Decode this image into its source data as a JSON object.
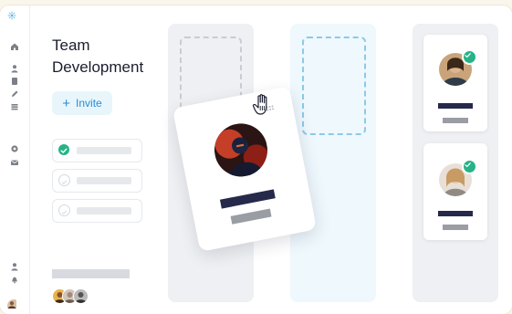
{
  "app": {
    "title": "Team Development",
    "invite_label": "Invite"
  },
  "rail": {
    "icons": [
      "home-icon",
      "user-icon",
      "document-icon",
      "pen-icon",
      "list-icon",
      "gear-icon",
      "mail-icon",
      "person-icon",
      "bell-icon"
    ]
  },
  "tasks": [
    {
      "state": "done"
    },
    {
      "state": "todo"
    },
    {
      "state": "todo"
    }
  ],
  "colors": {
    "accent": "#2a8bd6",
    "success": "#26b387",
    "name_bar": "#26294a",
    "column_gray": "#eef0f3",
    "column_blue": "#eff8fd"
  }
}
